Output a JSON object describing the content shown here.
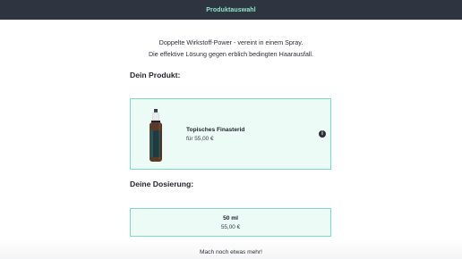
{
  "header": {
    "title": "Produktauswahl"
  },
  "tagline": {
    "line1": "Doppelte Wirkstoff-Power - vereint in einem Spray.",
    "line2": "Die effektive Lösung gegen erblich bedingten Haarausfall."
  },
  "product_section": {
    "heading": "Dein Produkt:",
    "product": {
      "name": "Topisches Finasterid",
      "price": "für 55,00 €",
      "info_icon": "info-icon"
    }
  },
  "dosage_section": {
    "heading": "Deine Dosierung:",
    "option": {
      "amount": "50 ml",
      "price": "55,00 €"
    }
  },
  "footer": {
    "more_text": "Mach noch etwas mehr!"
  },
  "colors": {
    "header_bg": "#2f3540",
    "accent": "#8ee6cc",
    "card_bg": "#ecfbf6",
    "card_border": "#7fdcc0"
  }
}
